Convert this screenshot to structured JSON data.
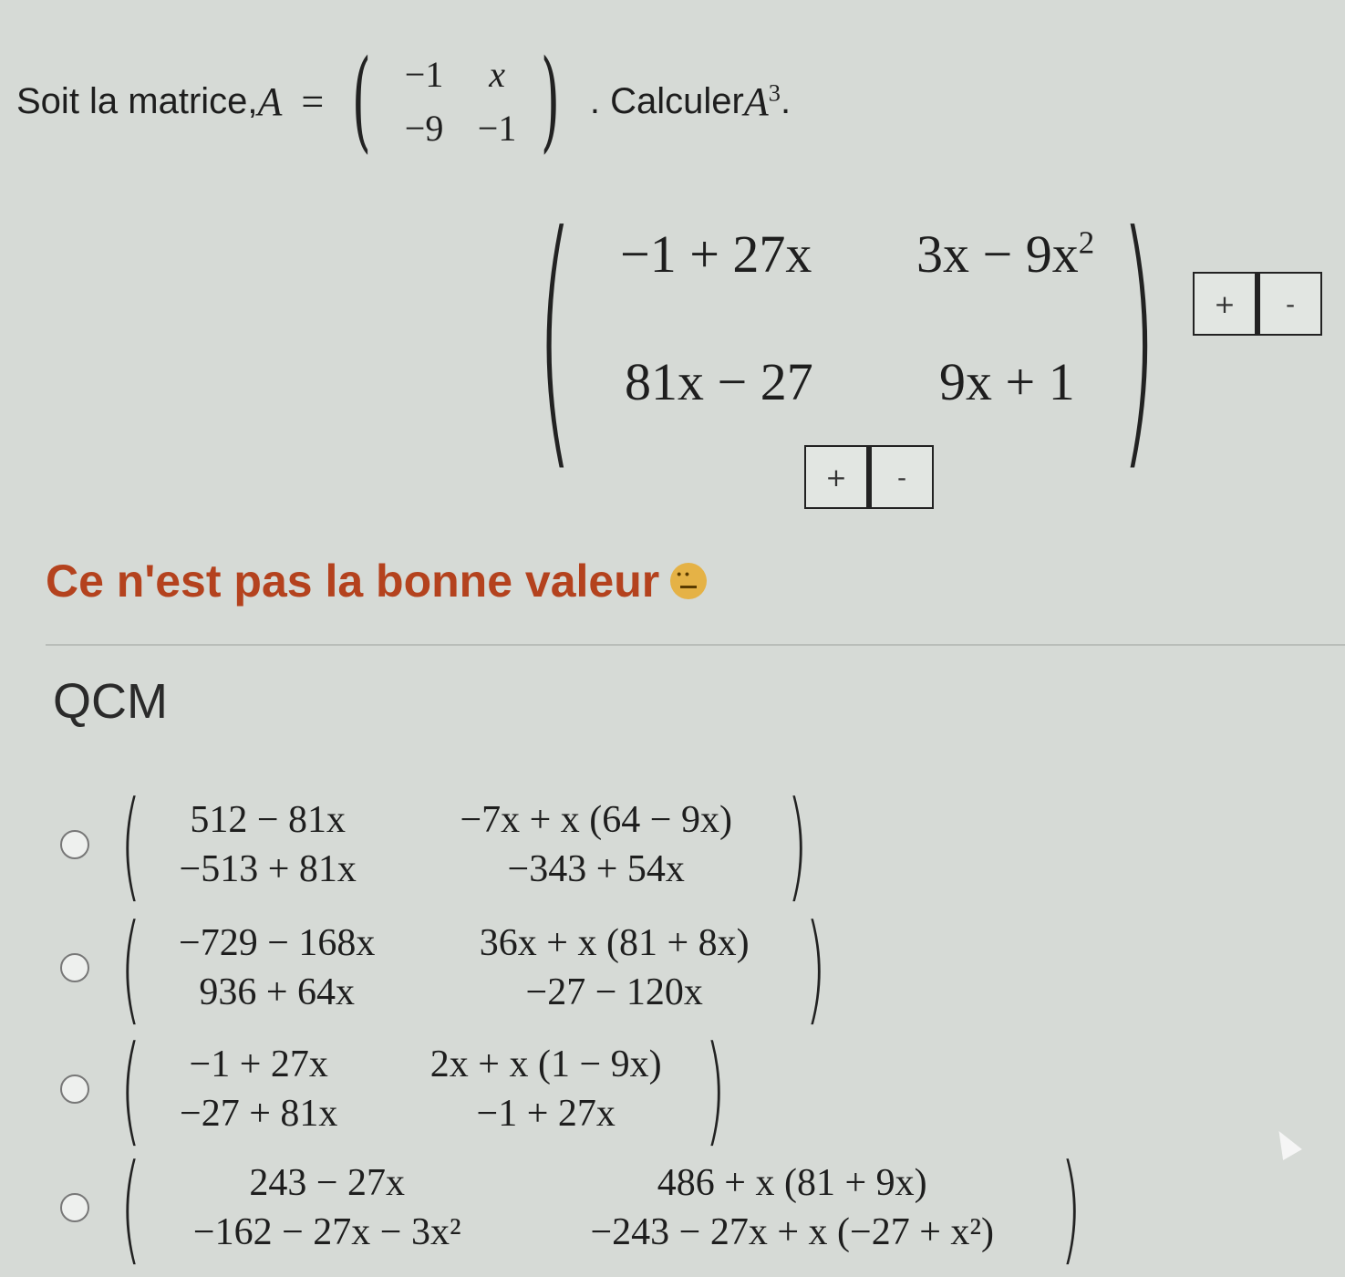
{
  "question": {
    "prefix": "Soit la matrice, ",
    "var_A": "A",
    "equals": "=",
    "matrix": [
      "−1",
      "x",
      "−9",
      "−1"
    ],
    "suffix": ". Calculer ",
    "power_base": "A",
    "power_exp": "3",
    "end": "."
  },
  "answer": {
    "cells": [
      "−1 + 27x",
      "3x − 9x",
      "81x − 27",
      "9x + 1"
    ],
    "cell12_exp": "2",
    "plus_label": "+",
    "minus_label": "-"
  },
  "feedback": {
    "text": "Ce n'est pas la bonne valeur",
    "icon": "sad-face-icon"
  },
  "qcm": {
    "title": "QCM",
    "options": [
      {
        "cells": [
          "512 − 81x",
          "−7x + x (64 − 9x)",
          "−513 + 81x",
          "−343 + 54x"
        ]
      },
      {
        "cells": [
          "−729 − 168x",
          "36x + x (81 + 8x)",
          "936 + 64x",
          "−27 − 120x"
        ]
      },
      {
        "cells": [
          "−1 + 27x",
          "2x + x (1 − 9x)",
          "−27 + 81x",
          "−1 + 27x"
        ]
      },
      {
        "cells": [
          "243 − 27x",
          "486 + x (81 + 9x)",
          "−162 − 27x − 3x²",
          "−243 − 27x + x (−27 + x²)"
        ]
      }
    ]
  }
}
